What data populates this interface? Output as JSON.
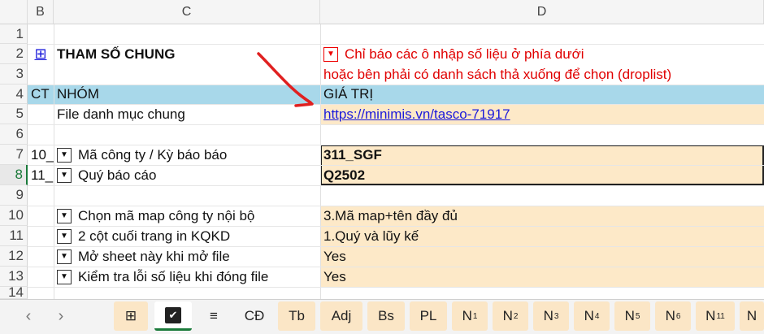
{
  "columns": [
    "B",
    "C",
    "D"
  ],
  "rows": [
    "1",
    "2",
    "3",
    "4",
    "5",
    "6",
    "7",
    "8",
    "9",
    "10",
    "11",
    "12",
    "13",
    "14"
  ],
  "header": {
    "expand_icon_label": "⊞",
    "section_title": "THAM SỐ CHUNG",
    "note_line1": "Chỉ báo các ô nhập số liệu ở phía dưới",
    "note_line2": "hoặc bên phải có danh sách thả xuống để chọn (droplist)"
  },
  "table_header": {
    "ct": "CT",
    "nhom": "NHÓM",
    "gia_tri": "GIÁ TRỊ"
  },
  "rows_data": {
    "r5": {
      "label": "File danh mục chung",
      "value": "https://minimis.vn/tasco-71917"
    },
    "r7": {
      "ct": "10_",
      "label": "Mã công ty / Kỳ báo báo",
      "value": "311_SGF"
    },
    "r8": {
      "ct": "11_",
      "label": "Quý báo cáo",
      "value": "Q2502"
    },
    "r10": {
      "label": "Chọn mã map công ty nội bộ",
      "value": "3.Mã map+tên đầy đủ"
    },
    "r11": {
      "label": "2 cột cuối trang in KQKD",
      "value": "1.Quý và lũy kế"
    },
    "r12": {
      "label": "Mở sheet này khi mở file",
      "value": "Yes"
    },
    "r13": {
      "label": "Kiểm tra lỗi số liệu khi đóng file",
      "value": "Yes"
    }
  },
  "tabs": {
    "grid_icon": "⊞",
    "check_icon": "✔",
    "menu_icon": "≡",
    "items": [
      "CĐ",
      "Tb",
      "Adj",
      "Bs",
      "PL"
    ],
    "n_tabs": [
      {
        "base": "N",
        "sup": "1"
      },
      {
        "base": "N",
        "sup": "2"
      },
      {
        "base": "N",
        "sup": "3"
      },
      {
        "base": "N",
        "sup": "4"
      },
      {
        "base": "N",
        "sup": "5"
      },
      {
        "base": "N",
        "sup": "6"
      },
      {
        "base": "N",
        "sup": "11"
      },
      {
        "base": "N",
        "sup": ""
      }
    ]
  },
  "colors": {
    "header_blue": "#a8d8ea",
    "peach": "#fde9c8",
    "note_red": "#e00000",
    "link_blue": "#1a1adb"
  }
}
